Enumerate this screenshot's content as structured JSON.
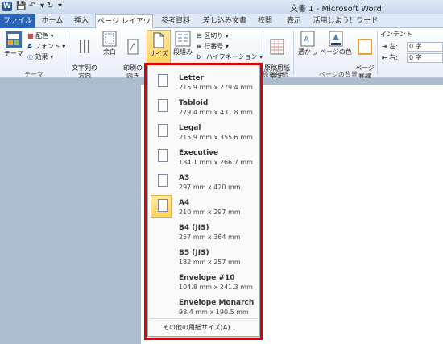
{
  "titlebar": {
    "title": "文書 1 - Microsoft Word",
    "app_icon": "W"
  },
  "tabs": [
    {
      "label": "ファイル"
    },
    {
      "label": "ホーム"
    },
    {
      "label": "挿入"
    },
    {
      "label": "ページ レイアウト"
    },
    {
      "label": "参考資料"
    },
    {
      "label": "差し込み文書"
    },
    {
      "label": "校閲"
    },
    {
      "label": "表示"
    },
    {
      "label": "活用しよう！ワード"
    }
  ],
  "ribbon": {
    "theme": "テーマ",
    "colors": "配色",
    "fonts": "フォント",
    "effects": "効果",
    "theme_group": "テーマ",
    "text_direction": "文字列の\n方向",
    "margins": "余白",
    "orientation": "印刷の\n向き",
    "size": "サイズ",
    "columns": "段組み",
    "breaks": "区切り",
    "line_numbers": "行番号",
    "hyphenation": "ハイフネーション",
    "manuscript": "原稿用紙\n設定",
    "manuscript_group": "原稿用紙",
    "watermark": "透かし",
    "page_color": "ページの色",
    "page_border": "ページ\n罫線",
    "page_bg_group": "ページの背景",
    "indent_label": "インデント",
    "indent_left_label": "左:",
    "indent_left_value": "0 字",
    "indent_right_label": "右:",
    "indent_right_value": "0 字"
  },
  "paper_sizes": [
    {
      "name": "Letter",
      "dims": "215.9 mm x 279.4 mm",
      "icon": true
    },
    {
      "name": "Tabloid",
      "dims": "279.4 mm x 431.8 mm",
      "icon": true
    },
    {
      "name": "Legal",
      "dims": "215.9 mm x 355.6 mm",
      "icon": true
    },
    {
      "name": "Executive",
      "dims": "184.1 mm x 266.7 mm",
      "icon": true
    },
    {
      "name": "A3",
      "dims": "297 mm x 420 mm",
      "icon": true
    },
    {
      "name": "A4",
      "dims": "210 mm x 297 mm",
      "icon": true,
      "selected": true
    },
    {
      "name": "B4 (JIS)",
      "dims": "257 mm x 364 mm",
      "icon": false
    },
    {
      "name": "B5 (JIS)",
      "dims": "182 mm x 257 mm",
      "icon": false
    },
    {
      "name": "Envelope #10",
      "dims": "104.8 mm x 241.3 mm",
      "icon": false
    },
    {
      "name": "Envelope Monarch",
      "dims": "98.4 mm x 190.5 mm",
      "icon": false
    }
  ],
  "more_sizes": "その他の用紙サイズ(A)...",
  "colors": {
    "accent_red": "#e00000",
    "file_tab": "#2a65b9",
    "selected_bg": "#ffd35d"
  }
}
